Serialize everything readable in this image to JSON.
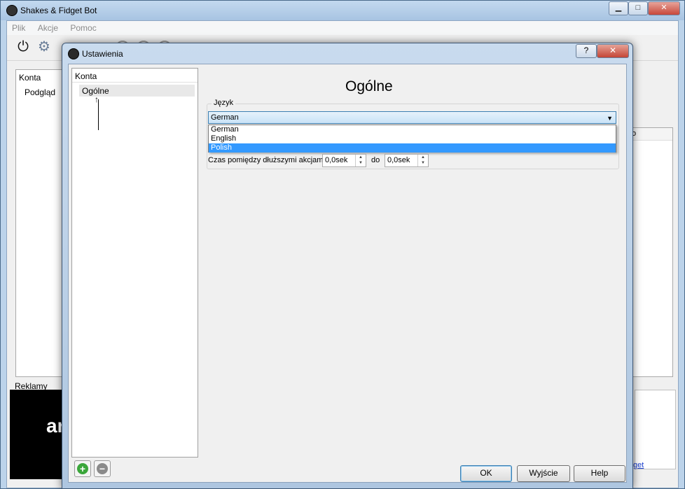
{
  "main_window": {
    "title": "Shakes & Fidget Bot",
    "menu": [
      "Plik",
      "Akcje",
      "Pomoc"
    ],
    "left_panel_header": "Konta",
    "left_panel_item": "Podgląd",
    "ads_label": "Reklamy",
    "ad_text": "ar",
    "right_column_header": "o",
    "right_link": "get",
    "window_controls": {
      "minimize": "▁",
      "maximize": "□",
      "close": "✕"
    }
  },
  "dialog": {
    "title": "Ustawienia",
    "help_btn": "?",
    "close_btn": "✕",
    "tree_header": "Konta",
    "tree_selected": "Ogólne",
    "arrow_glyph": "↑",
    "add_glyph": "+",
    "remove_glyph": "−",
    "page_title": "Ogólne",
    "language_group": "Język",
    "language_selected": "German",
    "language_options": [
      {
        "label": "German",
        "selected": false
      },
      {
        "label": "English",
        "selected": false
      },
      {
        "label": "Polish",
        "selected": true
      }
    ],
    "delay_label": "Czas pomiędzy dłuższymi akcjami:",
    "delay_from": "0,0sek",
    "delay_to_label": "do",
    "delay_to": "0,0sek",
    "buttons": {
      "ok": "OK",
      "exit": "Wyjście",
      "help": "Help"
    }
  },
  "colors": {
    "selection": "#3399ff",
    "title_bar": "#bcd3ea",
    "add_icon": "#3aa63a",
    "remove_icon": "#8a8a8a"
  }
}
